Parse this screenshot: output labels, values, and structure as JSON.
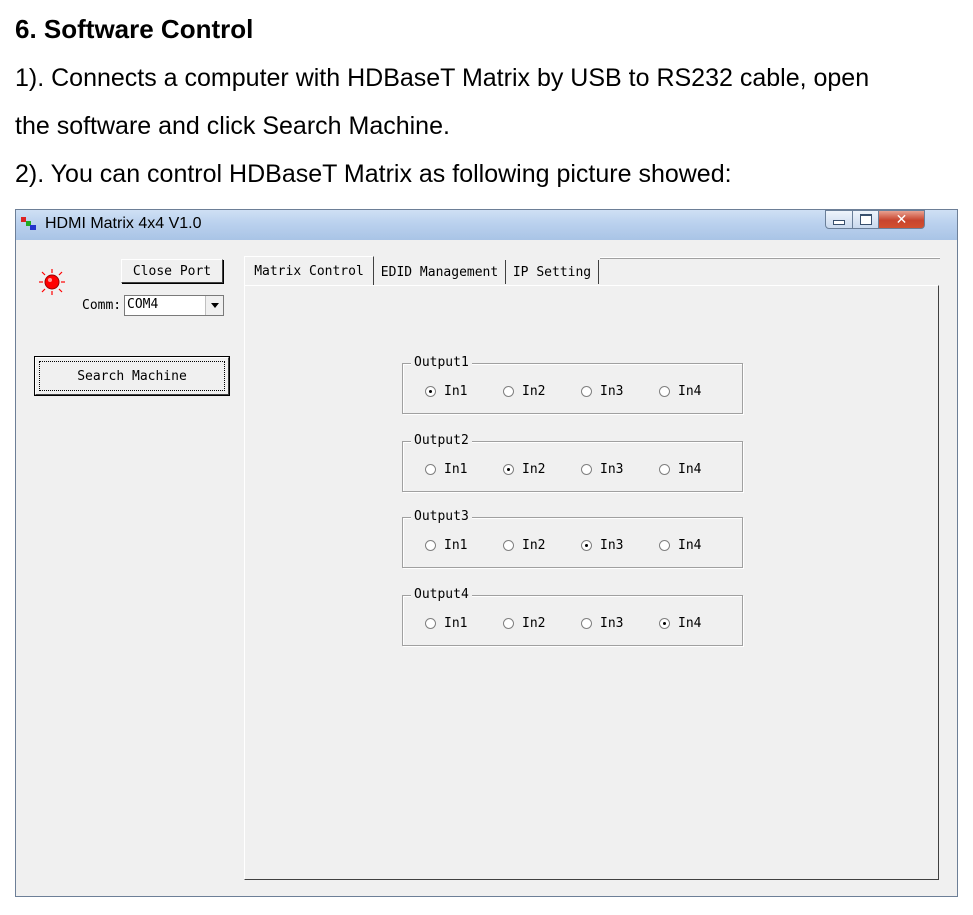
{
  "doc": {
    "heading": "6. Software Control",
    "para1_line1": "1). Connects a computer with HDBaseT Matrix by USB to RS232 cable, open",
    "para1_line2": "the software and click Search Machine.",
    "para2": "2). You can control HDBaseT Matrix as following picture showed:"
  },
  "window": {
    "title": "HDMI Matrix 4x4 V1.0",
    "close_port_label": "Close Port",
    "comm_label": "Comm:",
    "comm_value": "COM4",
    "search_label": "Search Machine",
    "status_led_color": "#ff0000",
    "tabs": [
      {
        "label": "Matrix Control",
        "active": true
      },
      {
        "label": "EDID Management",
        "active": false
      },
      {
        "label": "IP Setting",
        "active": false
      }
    ],
    "outputs": [
      {
        "label": "Output1",
        "selected": 0,
        "inputs": [
          "In1",
          "In2",
          "In3",
          "In4"
        ]
      },
      {
        "label": "Output2",
        "selected": 1,
        "inputs": [
          "In1",
          "In2",
          "In3",
          "In4"
        ]
      },
      {
        "label": "Output3",
        "selected": 2,
        "inputs": [
          "In1",
          "In2",
          "In3",
          "In4"
        ]
      },
      {
        "label": "Output4",
        "selected": 3,
        "inputs": [
          "In1",
          "In2",
          "In3",
          "In4"
        ]
      }
    ]
  }
}
